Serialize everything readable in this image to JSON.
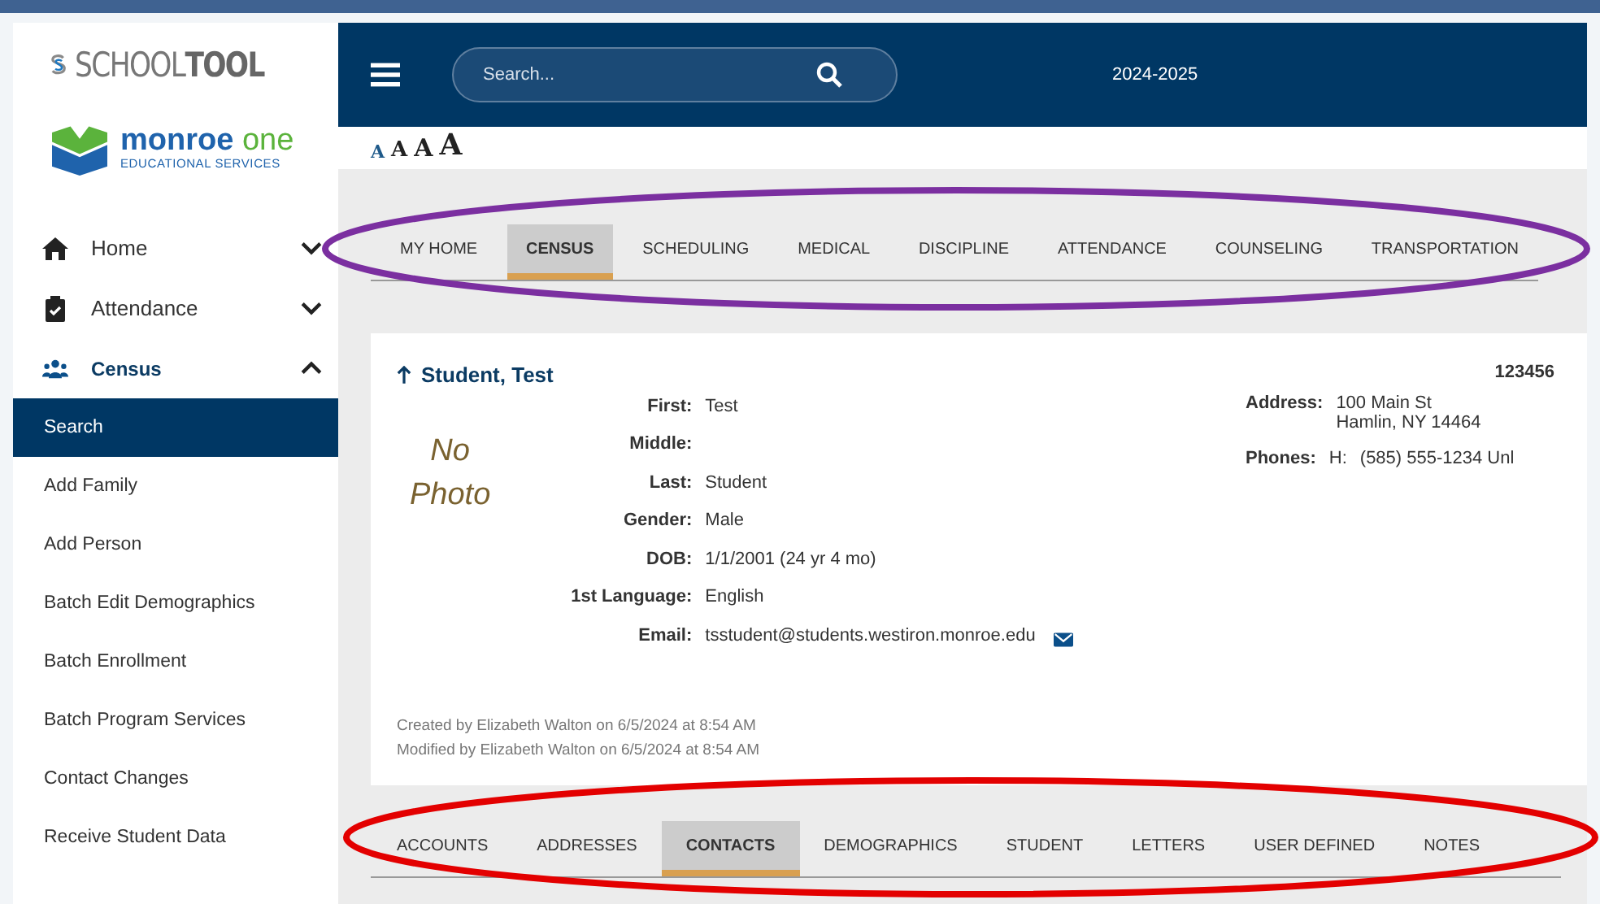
{
  "logo": {
    "name_light": "SCHOOL",
    "name_bold": "TOOL"
  },
  "partner_logo": {
    "name_bold": "monroe",
    "name_light": "one",
    "subtitle": "EDUCATIONAL SERVICES"
  },
  "sidebar": {
    "items": [
      {
        "label": "Home",
        "kind": "home",
        "expanded": false
      },
      {
        "label": "Attendance",
        "kind": "clipboard",
        "expanded": false
      },
      {
        "label": "Census",
        "kind": "people",
        "expanded": true
      }
    ],
    "subitems": [
      {
        "label": "Search",
        "selected": true
      },
      {
        "label": "Add Family",
        "selected": false
      },
      {
        "label": "Add Person",
        "selected": false
      },
      {
        "label": "Batch Edit Demographics",
        "selected": false
      },
      {
        "label": "Batch Enrollment",
        "selected": false
      },
      {
        "label": "Batch Program Services",
        "selected": false
      },
      {
        "label": "Contact Changes",
        "selected": false
      },
      {
        "label": "Receive Student Data",
        "selected": false
      }
    ]
  },
  "header": {
    "search": {
      "placeholder": "Search..."
    },
    "school_year": "2024-2025"
  },
  "font_sizes": [
    "A",
    "A",
    "A",
    "A"
  ],
  "main_tabs": [
    {
      "label": "MY HOME",
      "selected": false
    },
    {
      "label": "CENSUS",
      "selected": true
    },
    {
      "label": "SCHEDULING",
      "selected": false
    },
    {
      "label": "MEDICAL",
      "selected": false
    },
    {
      "label": "DISCIPLINE",
      "selected": false
    },
    {
      "label": "ATTENDANCE",
      "selected": false
    },
    {
      "label": "COUNSELING",
      "selected": false
    },
    {
      "label": "TRANSPORTATION",
      "selected": false
    }
  ],
  "student": {
    "name": "Student, Test",
    "id": "123456",
    "photo_placeholder": "No Photo",
    "fields": [
      {
        "label": "First:",
        "value": "Test"
      },
      {
        "label": "Middle:"
      },
      {
        "label": "Last:",
        "value": "Student"
      },
      {
        "label": "Gender:",
        "value": "Male"
      },
      {
        "label": "DOB:",
        "value": "1/1/2001 (24 yr 4 mo)"
      },
      {
        "label": "1st Language:",
        "value": "English"
      },
      {
        "label": "Email:",
        "value": "tsstudent@students.westiron.monroe.edu",
        "kind": "email"
      }
    ],
    "address": {
      "label": "Address:",
      "lines": [
        "100 Main St",
        "Hamlin, NY 14464"
      ]
    },
    "phones": {
      "label": "Phones:",
      "type": "H:",
      "number": "(585) 555-1234 Unl"
    },
    "audit": [
      "Created by Elizabeth Walton on 6/5/2024 at 8:54 AM",
      "Modified by Elizabeth Walton on 6/5/2024 at 8:54 AM"
    ]
  },
  "sub_tabs": [
    {
      "label": "ACCOUNTS",
      "selected": false
    },
    {
      "label": "ADDRESSES",
      "selected": false
    },
    {
      "label": "CONTACTS",
      "selected": true
    },
    {
      "label": "DEMOGRAPHICS",
      "selected": false
    },
    {
      "label": "STUDENT",
      "selected": false
    },
    {
      "label": "LETTERS",
      "selected": false
    },
    {
      "label": "USER DEFINED",
      "selected": false
    },
    {
      "label": "NOTES",
      "selected": false
    }
  ],
  "annotations": [
    {
      "kind": "ellipse",
      "color": "#7b2fa0"
    },
    {
      "kind": "ellipse",
      "color": "#e30000"
    }
  ]
}
